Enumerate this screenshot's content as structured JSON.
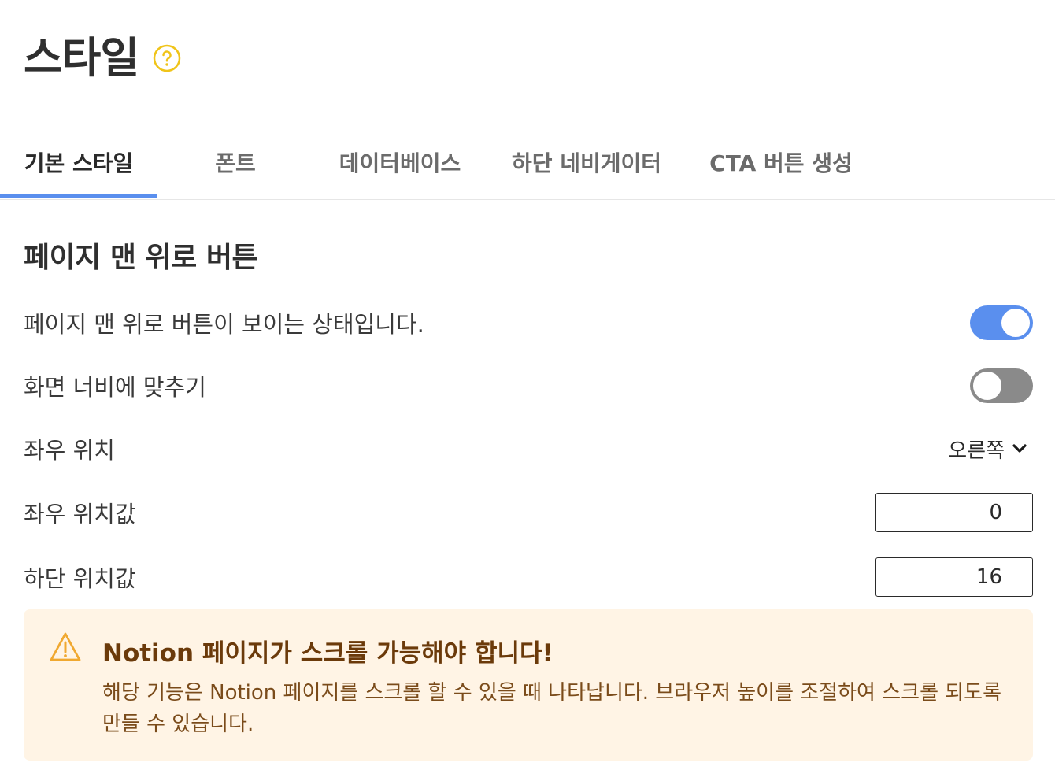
{
  "header": {
    "title": "스타일",
    "help_icon": "question-circle-icon"
  },
  "tabs": [
    {
      "label": "기본 스타일",
      "active": true
    },
    {
      "label": "폰트",
      "active": false
    },
    {
      "label": "데이터베이스",
      "active": false
    },
    {
      "label": "하단 네비게이터",
      "active": false
    },
    {
      "label": "CTA 버튼 생성",
      "active": false
    }
  ],
  "section": {
    "title": "페이지 맨 위로 버튼",
    "visible_toggle": {
      "label": "페이지 맨 위로 버튼이 보이는 상태입니다.",
      "on": true
    },
    "fit_width_toggle": {
      "label": "화면 너비에 맞추기",
      "on": false
    },
    "horizontal_position": {
      "label": "좌우 위치",
      "value": "오른쪽"
    },
    "horizontal_offset": {
      "label": "좌우 위치값",
      "value": "0"
    },
    "bottom_offset": {
      "label": "하단 위치값",
      "value": "16"
    }
  },
  "callout": {
    "icon": "warning-icon",
    "title": "Notion 페이지가 스크롤 가능해야 합니다!",
    "body": "해당 기능은 Notion 페이지를 스크롤 할 수 있을 때 나타납니다. 브라우저 높이를 조절하여 스크롤 되도록 만들 수 있습니다."
  },
  "colors": {
    "accent": "#5a8fee",
    "help_icon": "#f0c419",
    "warning_bg": "#fff4e5",
    "warning_title": "#6b3a0a",
    "warning_icon": "#f0a830"
  }
}
